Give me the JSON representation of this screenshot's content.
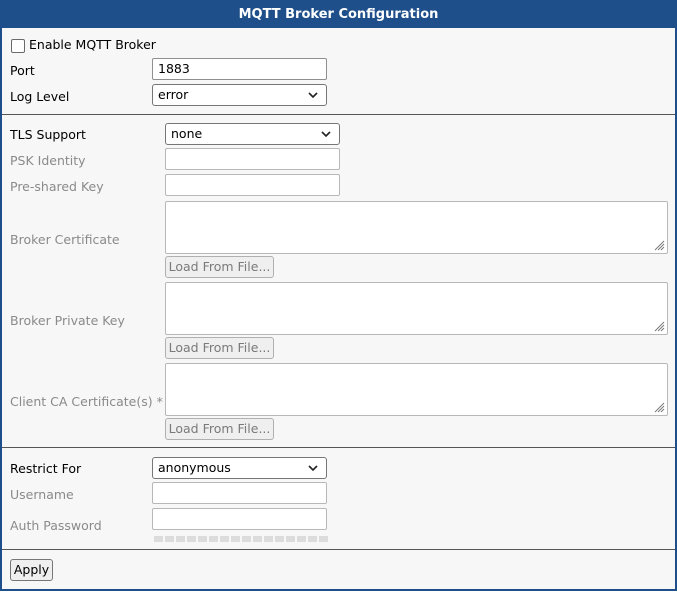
{
  "title": "MQTT Broker Configuration",
  "general": {
    "enable_label": "Enable MQTT Broker",
    "enable_checked": false,
    "port_label": "Port",
    "port_value": "1883",
    "log_level_label": "Log Level",
    "log_level_value": "error"
  },
  "tls": {
    "tls_support_label": "TLS Support",
    "tls_support_value": "none",
    "psk_identity_label": "PSK Identity",
    "psk_identity_value": "",
    "psk_key_label": "Pre-shared Key",
    "psk_key_value": "",
    "broker_cert_label": "Broker Certificate",
    "broker_key_label": "Broker Private Key",
    "client_ca_label": "Client CA Certificate(s) *",
    "load_from_file_label": "Load From File..."
  },
  "auth": {
    "restrict_for_label": "Restrict For",
    "restrict_for_value": "anonymous",
    "username_label": "Username",
    "username_value": "",
    "password_label": "Auth Password",
    "password_value": ""
  },
  "apply_label": "Apply",
  "icons": [
    "chevron-down-icon",
    "resize-grip-icon"
  ]
}
